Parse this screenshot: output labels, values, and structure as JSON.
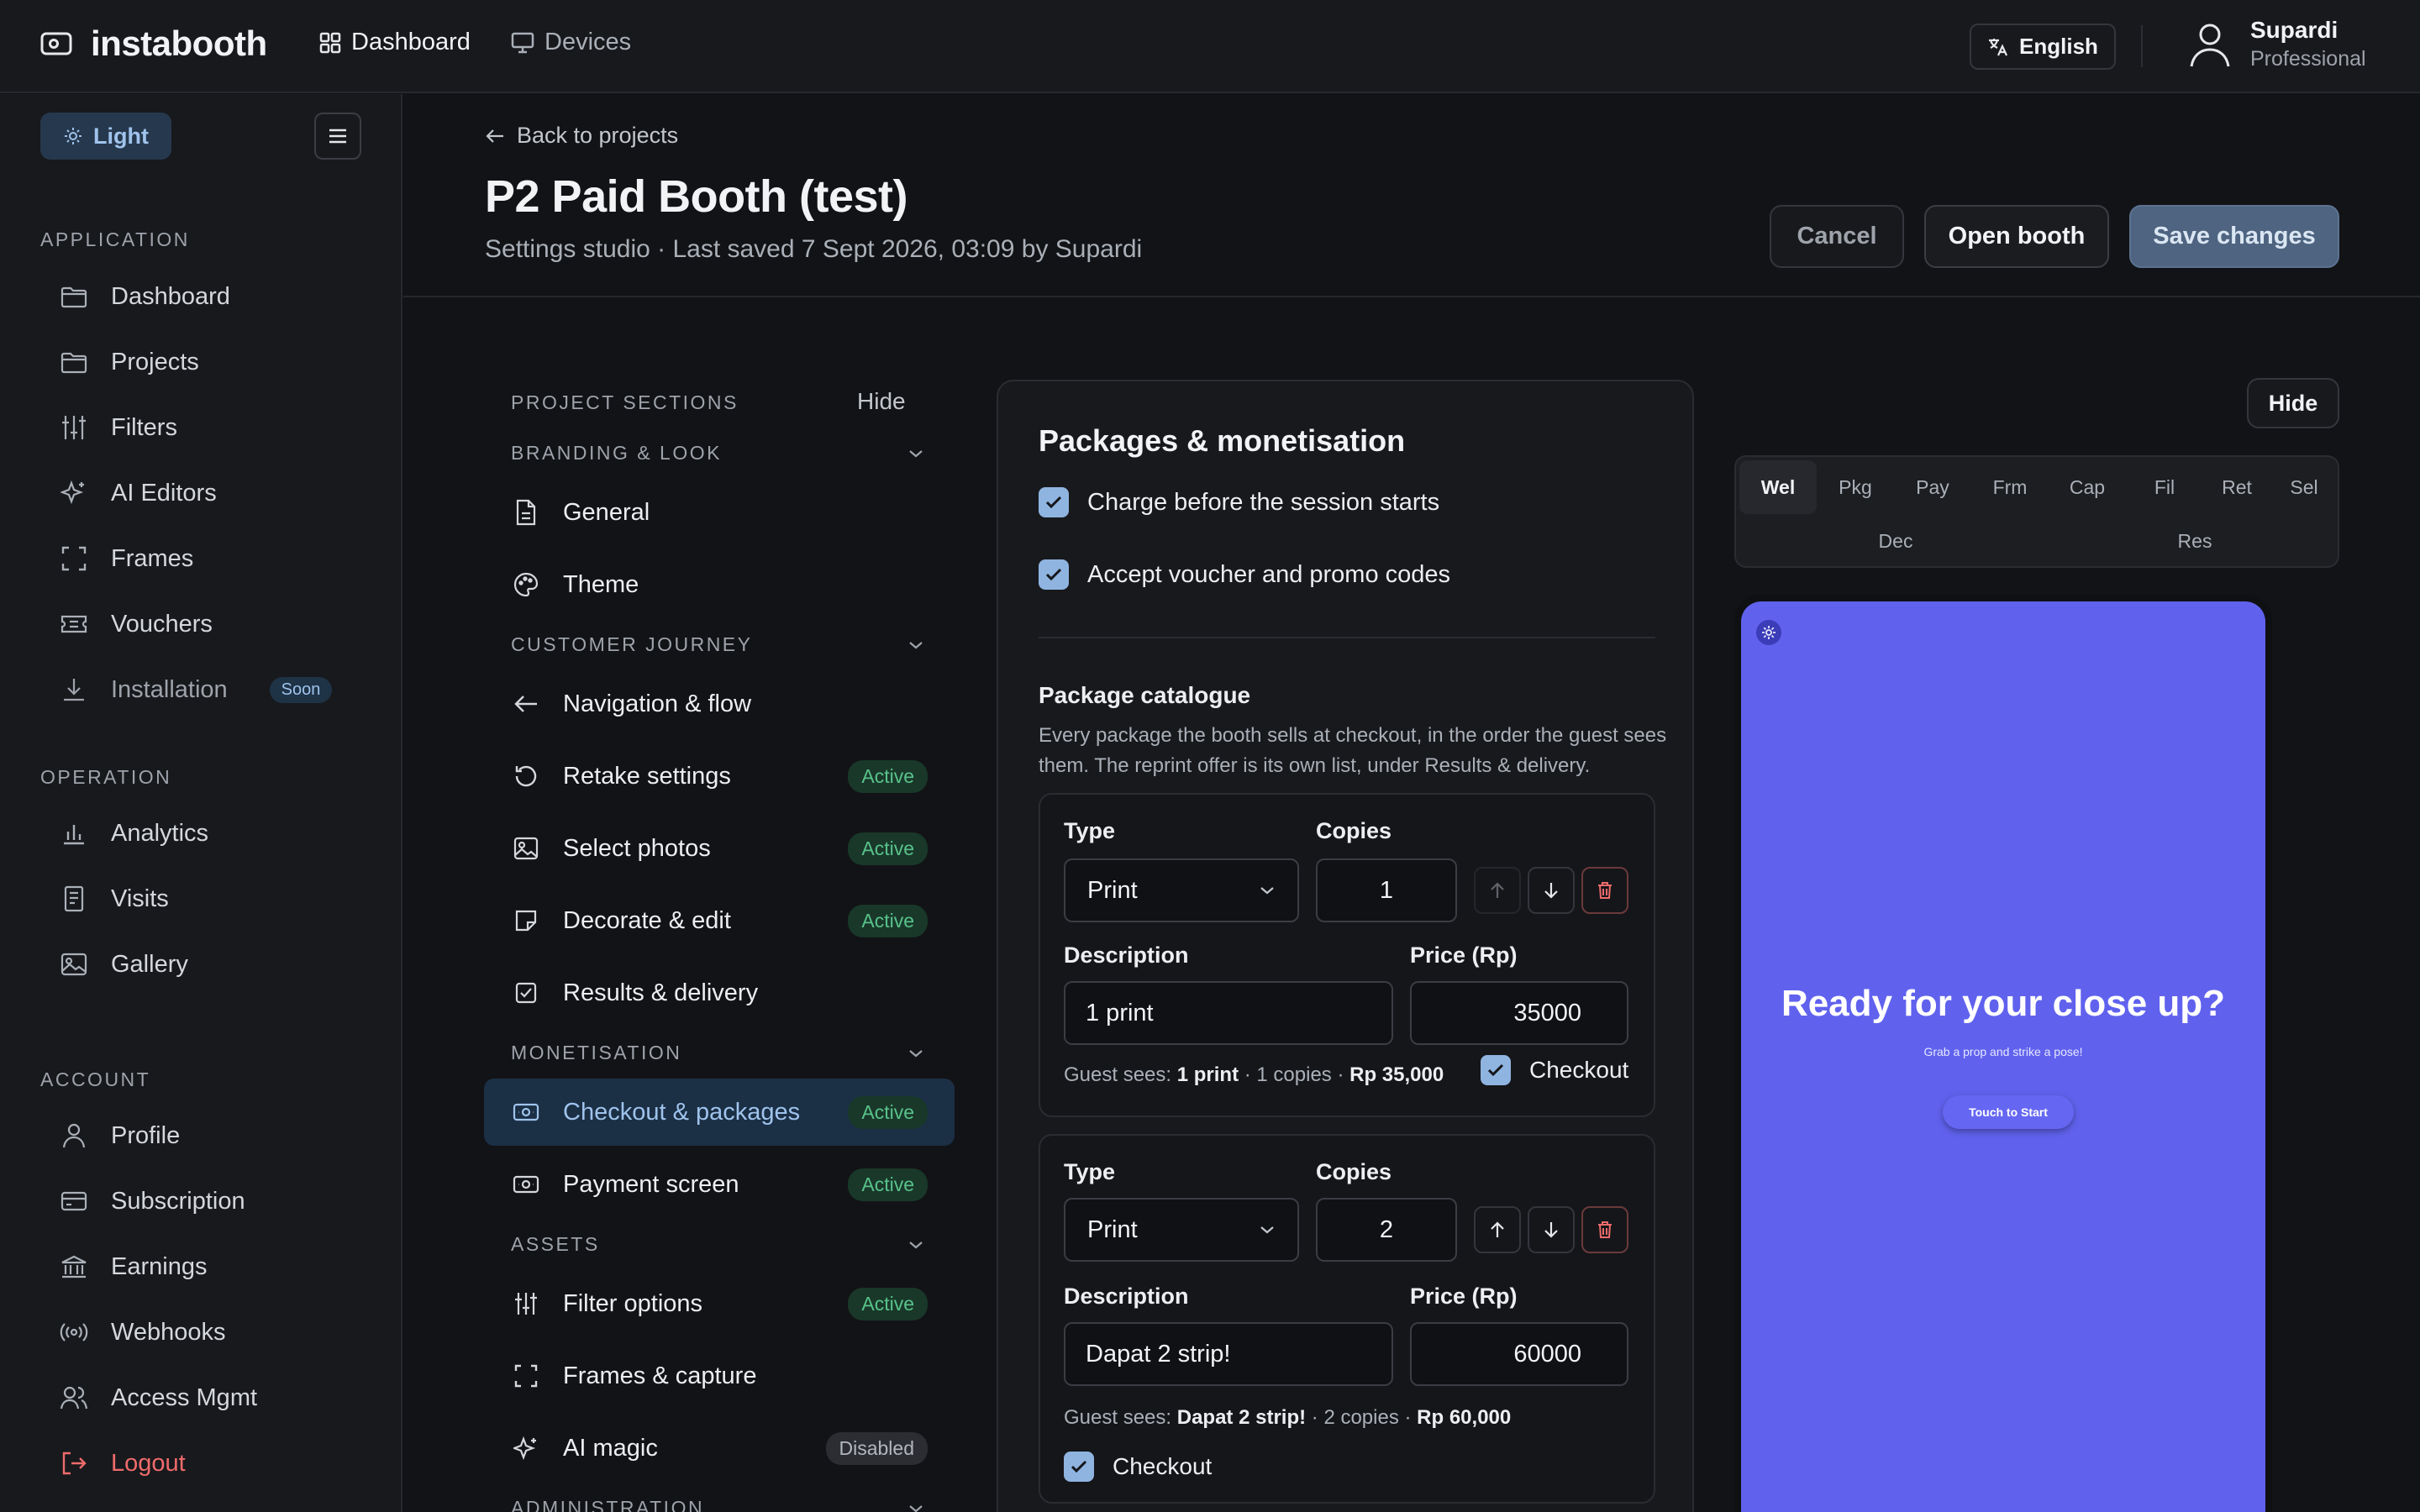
{
  "app": {
    "name": "instabooth"
  },
  "topnav": {
    "dashboard": "Dashboard",
    "devices": "Devices"
  },
  "language": "English",
  "user": {
    "name": "Supardi",
    "role": "Professional"
  },
  "sidebar": {
    "theme_toggle": "Light",
    "sections": {
      "application": "APPLICATION",
      "operation": "OPERATION",
      "account": "ACCOUNT"
    },
    "application_items": [
      "Dashboard",
      "Projects",
      "Filters",
      "AI Editors",
      "Frames",
      "Vouchers",
      "Installation"
    ],
    "installation_badge": "Soon",
    "operation_items": [
      "Analytics",
      "Visits",
      "Gallery"
    ],
    "account_items": [
      "Profile",
      "Subscription",
      "Earnings",
      "Webhooks",
      "Access Mgmt"
    ],
    "logout": "Logout"
  },
  "header": {
    "back": "Back to projects",
    "title": "P2 Paid Booth (test)",
    "subtitle": "Settings studio · Last saved 7 Sept 2026, 03:09 by Supardi",
    "cancel": "Cancel",
    "open_booth": "Open booth",
    "save": "Save changes"
  },
  "project_sections": {
    "heading": "PROJECT SECTIONS",
    "hide": "Hide",
    "groups": {
      "branding": "BRANDING & LOOK",
      "journey": "CUSTOMER JOURNEY",
      "monetisation": "MONETISATION",
      "assets": "ASSETS",
      "administration": "ADMINISTRATION"
    },
    "items": {
      "general": "General",
      "theme": "Theme",
      "navigation": "Navigation & flow",
      "retake": "Retake settings",
      "select_photos": "Select photos",
      "decorate": "Decorate & edit",
      "results": "Results & delivery",
      "checkout": "Checkout & packages",
      "payment": "Payment screen",
      "filter_options": "Filter options",
      "frames_capture": "Frames & capture",
      "ai_magic": "AI magic"
    },
    "badge_active": "Active",
    "badge_disabled": "Disabled"
  },
  "packages": {
    "title": "Packages & monetisation",
    "charge_before": "Charge before the session starts",
    "accept_voucher": "Accept voucher and promo codes",
    "catalogue_title": "Package catalogue",
    "catalogue_desc": "Every package the booth sells at checkout, in the order the guest sees them. The reprint offer is its own list, under Results & delivery.",
    "labels": {
      "type": "Type",
      "copies": "Copies",
      "description": "Description",
      "price": "Price (Rp)",
      "checkout": "Checkout",
      "guest_sees": "Guest sees:"
    },
    "items": [
      {
        "type": "Print",
        "copies": "1",
        "description": "1 print",
        "price": "35000",
        "guest_name": "1 print",
        "guest_copies": "· 1 copies ·",
        "guest_price": "Rp 35,000"
      },
      {
        "type": "Print",
        "copies": "2",
        "description": "Dapat 2 strip!",
        "price": "60000",
        "guest_name": "Dapat 2 strip!",
        "guest_copies": "· 2 copies ·",
        "guest_price": "Rp 60,000"
      }
    ]
  },
  "preview": {
    "hide": "Hide",
    "tabs": [
      "Wel",
      "Pkg",
      "Pay",
      "Frm",
      "Cap",
      "Fil",
      "Ret",
      "Sel",
      "Dec",
      "Res"
    ],
    "active_tab": "Wel",
    "screen_title": "Ready for your close up?",
    "screen_subtitle": "Grab a prop and strike a pose!",
    "screen_button": "Touch to Start",
    "screen_color": "#6062ee"
  },
  "colors": {
    "accent": "#8fb4e0",
    "active_badge": "#58c28a",
    "logout": "#ef6b6b"
  }
}
